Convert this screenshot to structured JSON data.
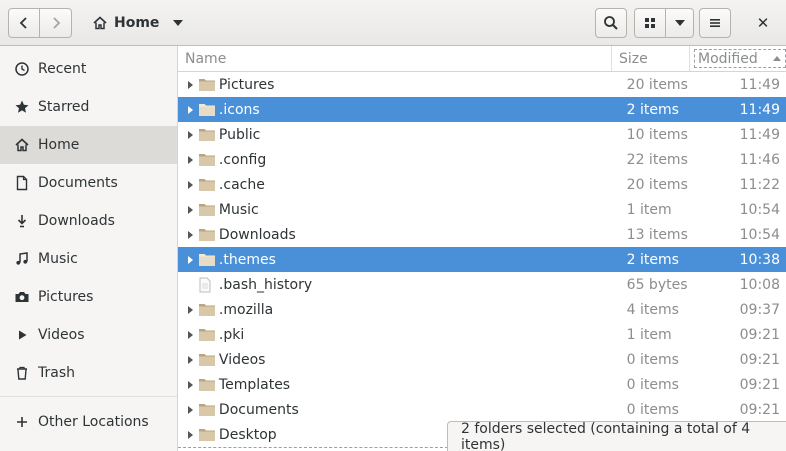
{
  "header": {
    "location_label": "Home",
    "close_glyph": "✕"
  },
  "sidebar": {
    "items": [
      {
        "label": "Recent",
        "icon": "clock-icon",
        "active": false
      },
      {
        "label": "Starred",
        "icon": "star-icon",
        "active": false
      },
      {
        "label": "Home",
        "icon": "home-icon",
        "active": true
      },
      {
        "label": "Documents",
        "icon": "document-icon",
        "active": false
      },
      {
        "label": "Downloads",
        "icon": "download-icon",
        "active": false
      },
      {
        "label": "Music",
        "icon": "music-icon",
        "active": false
      },
      {
        "label": "Pictures",
        "icon": "camera-icon",
        "active": false
      },
      {
        "label": "Videos",
        "icon": "video-icon",
        "active": false
      },
      {
        "label": "Trash",
        "icon": "trash-icon",
        "active": false
      }
    ],
    "other_locations": "Other Locations"
  },
  "columns": {
    "name": "Name",
    "size": "Size",
    "modified": "Modified"
  },
  "files": [
    {
      "name": "Pictures",
      "size": "20 items",
      "modified": "11:49",
      "folder": true,
      "badge": "camera",
      "selected": false
    },
    {
      "name": ".icons",
      "size": "2 items",
      "modified": "11:49",
      "folder": true,
      "badge": "",
      "selected": true
    },
    {
      "name": "Public",
      "size": "10 items",
      "modified": "11:49",
      "folder": true,
      "badge": "share",
      "selected": false
    },
    {
      "name": ".config",
      "size": "22 items",
      "modified": "11:46",
      "folder": true,
      "badge": "",
      "selected": false
    },
    {
      "name": ".cache",
      "size": "20 items",
      "modified": "11:22",
      "folder": true,
      "badge": "",
      "selected": false
    },
    {
      "name": "Music",
      "size": "1 item",
      "modified": "10:54",
      "folder": true,
      "badge": "music",
      "selected": false
    },
    {
      "name": "Downloads",
      "size": "13 items",
      "modified": "10:54",
      "folder": true,
      "badge": "download",
      "selected": false
    },
    {
      "name": ".themes",
      "size": "2 items",
      "modified": "10:38",
      "folder": true,
      "badge": "",
      "selected": true
    },
    {
      "name": ".bash_history",
      "size": "65 bytes",
      "modified": "10:08",
      "folder": false,
      "badge": "",
      "selected": false
    },
    {
      "name": ".mozilla",
      "size": "4 items",
      "modified": "09:37",
      "folder": true,
      "badge": "",
      "selected": false
    },
    {
      "name": ".pki",
      "size": "1 item",
      "modified": "09:21",
      "folder": true,
      "badge": "",
      "selected": false
    },
    {
      "name": "Videos",
      "size": "0 items",
      "modified": "09:21",
      "folder": true,
      "badge": "video",
      "selected": false
    },
    {
      "name": "Templates",
      "size": "0 items",
      "modified": "09:21",
      "folder": true,
      "badge": "template",
      "selected": false
    },
    {
      "name": "Documents",
      "size": "0 items",
      "modified": "09:21",
      "folder": true,
      "badge": "document",
      "selected": false
    },
    {
      "name": "Desktop",
      "size": "",
      "modified": "",
      "folder": true,
      "badge": "desktop",
      "selected": false
    }
  ],
  "status": {
    "text": "2 folders selected  (containing a total of 4 items)"
  },
  "colors": {
    "selection": "#4a90d9",
    "folder": "#d9c8a8"
  }
}
